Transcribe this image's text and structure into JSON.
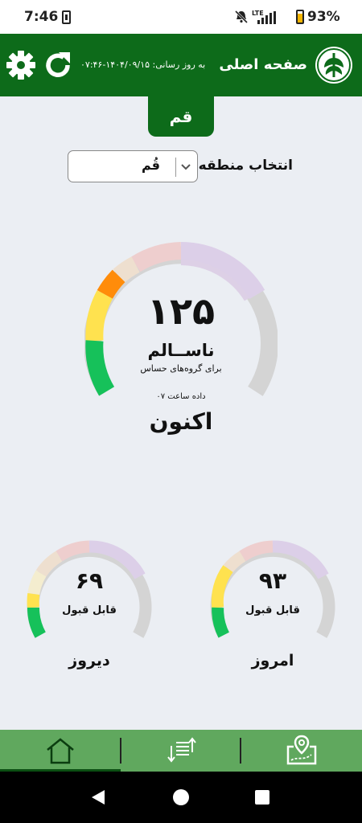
{
  "status_bar": {
    "time": "7:46",
    "network": "LTE",
    "battery": "93%"
  },
  "header": {
    "title": "صفحه اصلی",
    "updated_label": "به روز رسانی:",
    "updated_value": "۱۴۰۴/۰۹/۱۵-۰۷:۴۶"
  },
  "city_tab": "قم",
  "region": {
    "label": "انتخاب منطقه:",
    "selected": "قُم"
  },
  "main_gauge": {
    "value": "۱۲۵",
    "status": "ناســالم",
    "subtext": "برای گروه‌های حساس",
    "data_time": "داده ساعت ۰۷",
    "title": "اکنون",
    "fill_fraction": 0.3
  },
  "today_gauge": {
    "value": "۹۳",
    "status": "قابل قبول",
    "title": "امروز",
    "fill_fraction": 0.22
  },
  "yesterday_gauge": {
    "value": "۶۹",
    "status": "قابل قبول",
    "title": "دیروز",
    "fill_fraction": 0.16
  },
  "colors": {
    "primary": "#0d6b1a",
    "nav": "#60a85e",
    "good": "#16c15a",
    "moderate": "#ffe24f",
    "sensitive": "#ff8c0a",
    "track": "#d4d4d4"
  },
  "bottom_nav": [
    "home-icon",
    "sort-icon",
    "map-icon"
  ]
}
